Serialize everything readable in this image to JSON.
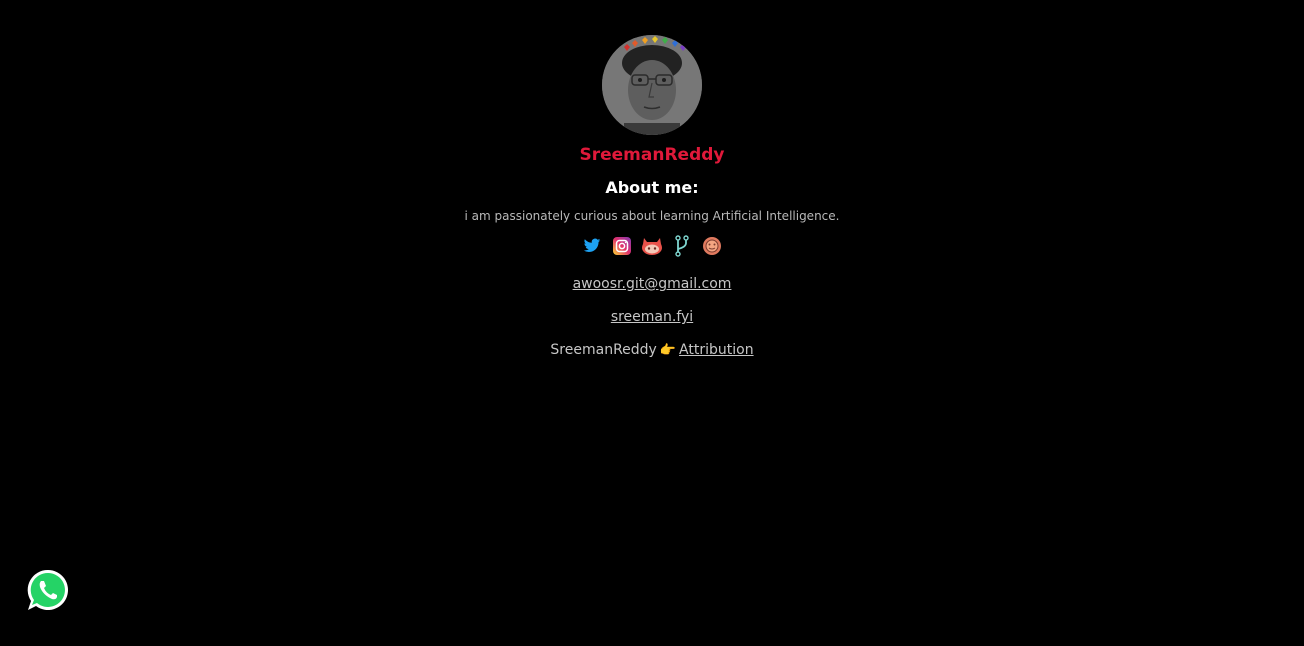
{
  "profile": {
    "name": "SreemanReddy",
    "about_title": "About me:",
    "about_text": "i am passionately curious about learning Artificial Intelligence.",
    "avatar_alt": "profile photo with rainbow hearts crown"
  },
  "socials": [
    {
      "name": "twitter",
      "icon": "twitter-bird-icon",
      "color": "#1da1f2"
    },
    {
      "name": "instagram",
      "icon": "instagram-icon",
      "color": "#e1306c"
    },
    {
      "name": "github",
      "icon": "github-octocat-icon",
      "color": "#e8524a"
    },
    {
      "name": "git-fork",
      "icon": "git-fork-icon",
      "color": "#7fd6d0"
    },
    {
      "name": "other",
      "icon": "orange-circle-icon",
      "color": "#e07a5f"
    }
  ],
  "links": {
    "email": "awoosr.git@gmail.com",
    "site": "sreeman.fyi",
    "attribution_prefix": "SreemanReddy",
    "attribution_emoji": "👉",
    "attribution_link": "Attribution"
  },
  "colors": {
    "background": "#000000",
    "name": "#e0193a",
    "whatsapp": "#25d366"
  },
  "floating": {
    "whatsapp_icon": "whatsapp-icon"
  }
}
